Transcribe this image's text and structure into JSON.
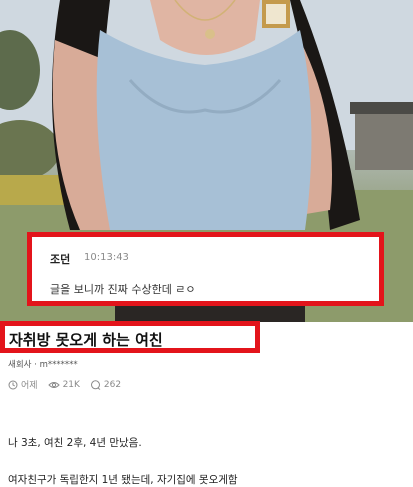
{
  "comment": {
    "author": "조던",
    "time": "10:13:43",
    "text": "글을 보니까 진짜 수상한데 ㄹㅇ"
  },
  "post": {
    "title": "자취방 못오게 하는 여친",
    "author": "새회사 · m*******",
    "date": "어제",
    "views": "21K",
    "comments": "262",
    "body_line1": "나 3초, 여친 2후, 4년 만났음.",
    "body_line2": "여자친구가 독립한지 1년 됐는데, 자기집에 못오게함"
  },
  "colors": {
    "highlight": "#e3141b",
    "meta": "#8a8a8a"
  },
  "icons": {
    "clock": "clock-icon",
    "eye": "eye-icon",
    "comment": "comment-icon"
  }
}
